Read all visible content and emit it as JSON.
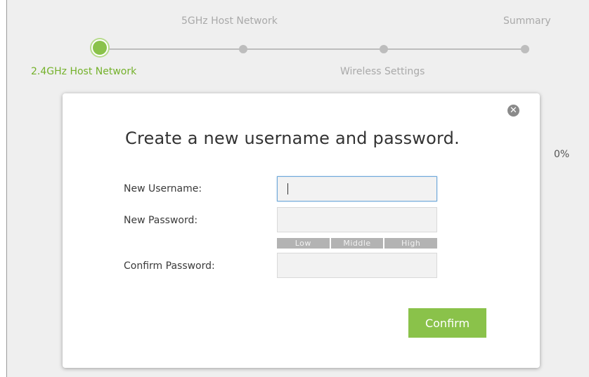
{
  "steps": {
    "step1": "2.4GHz Host Network",
    "step2": "5GHz Host Network",
    "step3": "Wireless Settings",
    "step4": "Summary",
    "active_index": 1
  },
  "progress_text": "0%",
  "modal": {
    "title": "Create a new username and password.",
    "username_label": "New Username:",
    "username_value": "",
    "password_label": "New Password:",
    "password_value": "",
    "strength": [
      "Low",
      "Middle",
      "High"
    ],
    "confirm_label": "Confirm Password:",
    "confirm_value": "",
    "confirm_button": "Confirm"
  },
  "colors": {
    "accent": "#8ac24a",
    "active_step_text": "#74b12b"
  }
}
